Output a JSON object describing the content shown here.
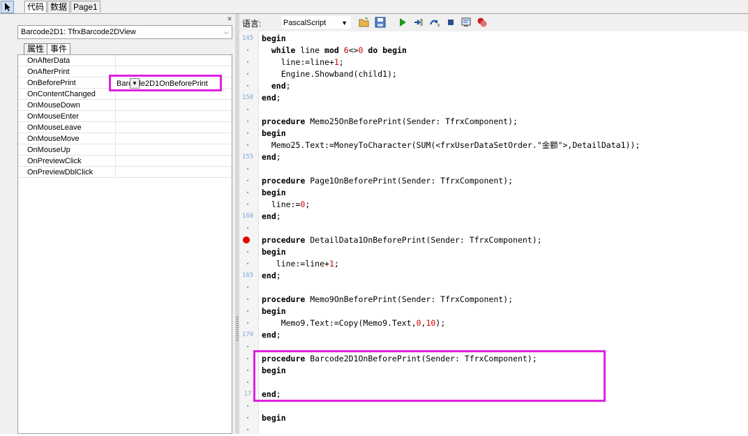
{
  "top_tabs": [
    "代码",
    "数据",
    "Page1"
  ],
  "object_inspector": {
    "selected_object": "Barcode2D1: TfrxBarcode2DView",
    "tabs": [
      "属性",
      "事件"
    ],
    "events": [
      "OnAfterData",
      "OnAfterPrint",
      "OnBeforePrint",
      "OnContentChanged",
      "OnMouseDown",
      "OnMouseEnter",
      "OnMouseLeave",
      "OnMouseMove",
      "OnMouseUp",
      "OnPreviewClick",
      "OnPreviewDblClick"
    ],
    "selected_event_value": "Barcode2D1OnBeforePrint"
  },
  "toolbar": {
    "language_label": "语言:",
    "language_value": "PascalScript",
    "icons": [
      "open-folder-icon",
      "save-icon",
      "run-icon",
      "step-into-icon",
      "step-over-icon",
      "stop-icon",
      "evaluate-icon",
      "breakpoint-icon"
    ]
  },
  "editor": {
    "gutter": [
      "145",
      "•",
      "•",
      "•",
      "•",
      "150",
      "•",
      "•",
      "•",
      "•",
      "155",
      "•",
      "•",
      "•",
      "•",
      "160",
      "•",
      "bp",
      "•",
      "•",
      "165",
      "•",
      "•",
      "•",
      "•",
      "170",
      "•",
      "•",
      "•",
      "•",
      "17",
      "•",
      "•",
      "•"
    ],
    "lines": [
      "begin",
      "  while line mod 6<>0 do begin",
      "    line:=line+1;",
      "    Engine.Showband(child1);",
      "  end;",
      "end;",
      "",
      "procedure Memo25OnBeforePrint(Sender: TfrxComponent);",
      "begin",
      "  Memo25.Text:=MoneyToCharacter(SUM(<frxUserDataSetOrder.\"金额\">,DetailData1));",
      "end;",
      "",
      "procedure Page1OnBeforePrint(Sender: TfrxComponent);",
      "begin",
      "  line:=0;",
      "end;",
      "",
      "procedure DetailData1OnBeforePrint(Sender: TfrxComponent);",
      "begin",
      "   line:=line+1;",
      "end;",
      "",
      "procedure Memo9OnBeforePrint(Sender: TfrxComponent);",
      "begin",
      "    Memo9.Text:=Copy(Memo9.Text,0,10);",
      "end;",
      "",
      "procedure Barcode2D1OnBeforePrint(Sender: TfrxComponent);",
      "begin",
      "",
      "end;",
      "",
      "begin",
      ""
    ]
  }
}
